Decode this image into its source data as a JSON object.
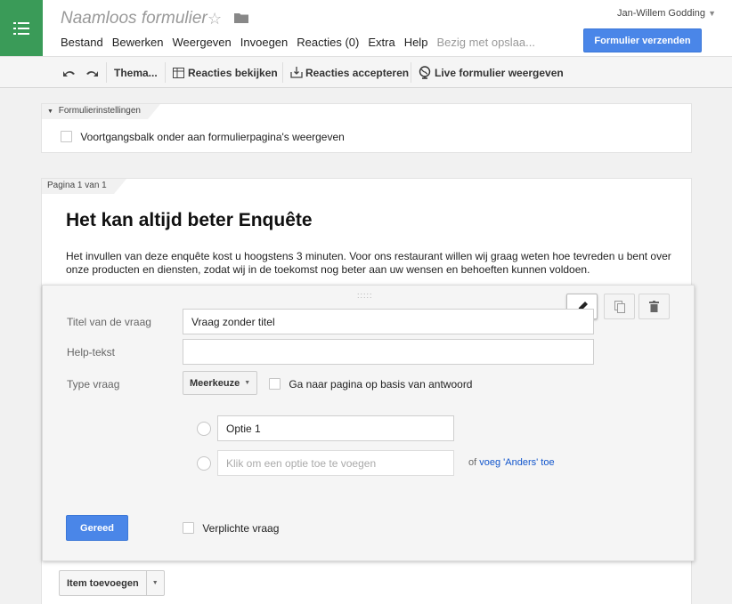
{
  "header": {
    "title": "Naamloos formulier",
    "user": "Jan-Willem Godding",
    "send_button": "Formulier verzenden",
    "menu": [
      "Bestand",
      "Bewerken",
      "Weergeven",
      "Invoegen",
      "Reacties (0)",
      "Extra",
      "Help"
    ],
    "saving_status": "Bezig met opslaa..."
  },
  "toolbar": {
    "theme": "Thema...",
    "view_responses": "Reacties bekijken",
    "accept_responses": "Reacties accepteren",
    "view_live": "Live formulier weergeven"
  },
  "settings": {
    "tab": "Formulierinstellingen",
    "progress_bar_label": "Voortgangsbalk onder aan formulierpagina's weergeven"
  },
  "page": {
    "tab": "Pagina 1 van 1",
    "form_title": "Het kan altijd beter Enquête",
    "description": "Het invullen van deze enquête kost u hoogstens 3 minuten. Voor ons restaurant willen wij graag weten hoe tevreden u bent over onze producten en diensten, zodat wij in de toekomst nog beter aan uw wensen en behoeften kunnen voldoen."
  },
  "question": {
    "drag_handle": ":::::",
    "title_label": "Titel van de vraag",
    "title_value": "Vraag zonder titel",
    "help_label": "Help-tekst",
    "help_value": "",
    "type_label": "Type vraag",
    "type_value": "Meerkeuze",
    "goto_page_label": "Ga naar pagina op basis van antwoord",
    "option1": "Optie 1",
    "add_option_placeholder": "Klik om een optie toe te voegen",
    "or_text": "of",
    "add_other_link": "voeg 'Anders' toe",
    "done_button": "Gereed",
    "required_label": "Verplichte vraag"
  },
  "add_item_button": "Item toevoegen",
  "colors": {
    "accent": "#4a86e8",
    "logo": "#3a9b58"
  }
}
